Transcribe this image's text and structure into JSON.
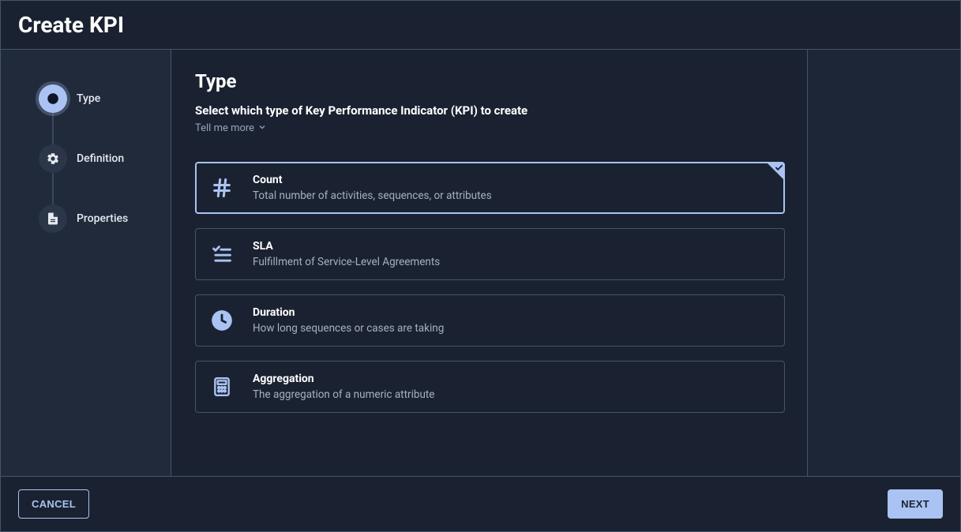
{
  "header": {
    "title": "Create KPI"
  },
  "sidebar": {
    "steps": [
      {
        "label": "Type",
        "icon": "half-circle-icon",
        "active": true
      },
      {
        "label": "Definition",
        "icon": "gear-icon",
        "active": false
      },
      {
        "label": "Properties",
        "icon": "document-icon",
        "active": false
      }
    ]
  },
  "content": {
    "heading": "Type",
    "subtitle": "Select which type of Key Performance Indicator (KPI) to create",
    "tell_me_more": "Tell me more",
    "options": [
      {
        "id": "count",
        "title": "Count",
        "description": "Total number of activities, sequences, or attributes",
        "icon": "hash-icon",
        "selected": true
      },
      {
        "id": "sla",
        "title": "SLA",
        "description": "Fulfillment of Service-Level Agreements",
        "icon": "checklist-icon",
        "selected": false
      },
      {
        "id": "duration",
        "title": "Duration",
        "description": "How long sequences or cases are taking",
        "icon": "clock-icon",
        "selected": false
      },
      {
        "id": "aggregation",
        "title": "Aggregation",
        "description": "The aggregation of a numeric attribute",
        "icon": "calculator-icon",
        "selected": false
      }
    ]
  },
  "footer": {
    "cancel_label": "CANCEL",
    "next_label": "NEXT"
  }
}
